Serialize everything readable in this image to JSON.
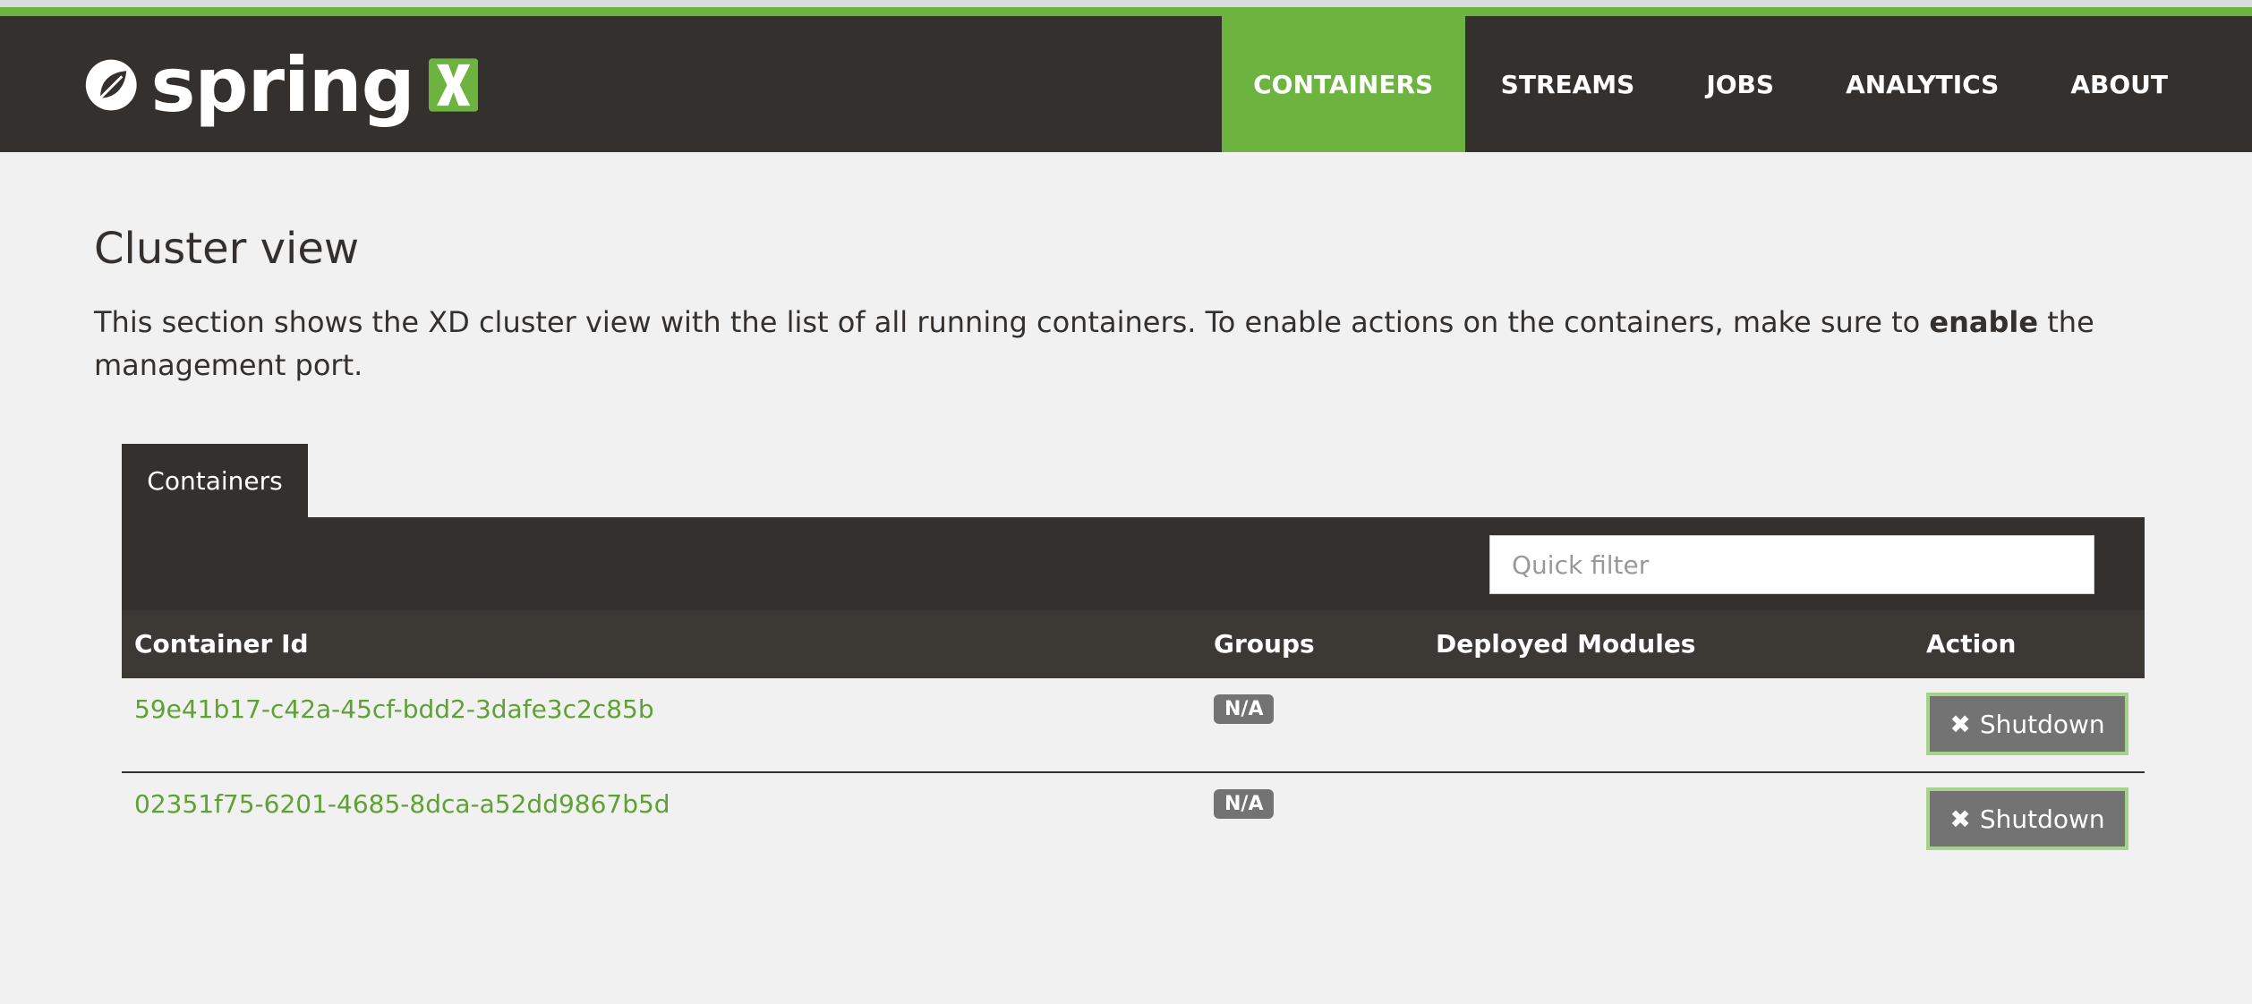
{
  "brand": {
    "name": "spring",
    "accent": "#6db33f",
    "dark": "#34302d"
  },
  "nav": {
    "items": [
      {
        "label": "CONTAINERS",
        "active": true
      },
      {
        "label": "STREAMS",
        "active": false
      },
      {
        "label": "JOBS",
        "active": false
      },
      {
        "label": "ANALYTICS",
        "active": false
      },
      {
        "label": "ABOUT",
        "active": false
      }
    ]
  },
  "page": {
    "title": "Cluster view",
    "intro_before": "This section shows the XD cluster view with the list of all running containers. To enable actions on the containers, make sure to ",
    "intro_bold": "enable",
    "intro_after": " the management port."
  },
  "tab": {
    "label": "Containers"
  },
  "filter": {
    "placeholder": "Quick filter",
    "value": ""
  },
  "table": {
    "columns": [
      "Container Id",
      "Groups",
      "Deployed Modules",
      "Action"
    ],
    "rows": [
      {
        "container_id": "59e41b17-c42a-45cf-bdd2-3dafe3c2c85b",
        "groups": "N/A",
        "modules": "",
        "action": "Shutdown"
      },
      {
        "container_id": "02351f75-6201-4685-8dca-a52dd9867b5d",
        "groups": "N/A",
        "modules": "",
        "action": "Shutdown"
      }
    ]
  },
  "icons": {
    "close": "close-icon",
    "leaf": "spring-leaf-icon"
  }
}
